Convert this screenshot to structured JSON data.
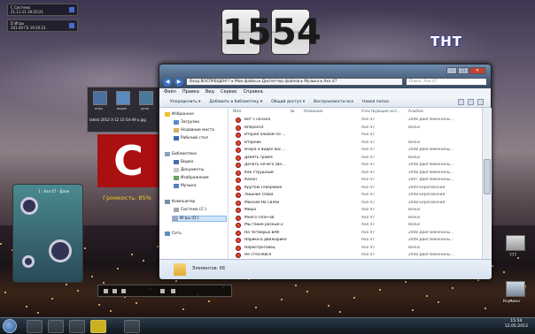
{
  "desktop": {
    "widget1": {
      "line1": "С  Система",
      "line2": "21.11.11  19:20:21"
    },
    "widget2": {
      "line1": "D  Игры",
      "line2": "101.40 ГБ  19:20:21"
    },
    "clock": {
      "hours": "15",
      "minutes": "54"
    },
    "tv_logo": "ТНТ",
    "gadget": {
      "items": [
        "игры",
        "видео",
        "дела"
      ],
      "file": "latest 2012-3-12 15-54-49 а.jpg"
    },
    "red_logo": "C",
    "volume": "Громкость: 85%",
    "player_title": "1 : Аха 47 - Дали",
    "icons": [
      {
        "label": "777"
      },
      {
        "label": "Корзина"
      }
    ]
  },
  "explorer": {
    "title_buttons": [
      "–",
      "□",
      "✕"
    ],
    "address": [
      "Вход ВОСПРЕЩЕН!!!",
      "Мои файлы",
      "Диспетчер файлов",
      "Музыка",
      "Аха 47"
    ],
    "search_placeholder": "Поиск: Аха 47",
    "menu": [
      "Файл",
      "Правка",
      "Вид",
      "Сервис",
      "Справка"
    ],
    "toolbar": [
      "Упорядочить ▾",
      "Добавить в библиотеку ▾",
      "Общий доступ ▾",
      "Воспроизвести все",
      "Новая папка"
    ],
    "nav": {
      "favorites": "Избранное",
      "favorites_items": [
        "Загрузки",
        "Недавние места",
        "Рабочий стол"
      ],
      "libraries": "Библиотеки",
      "libraries_items": [
        "Видео",
        "Документы",
        "Изображения",
        "Музыка"
      ],
      "computer": "Компьютер",
      "computer_items": [
        "Система (C:)",
        "Игры (D:)"
      ],
      "network": "Сеть"
    },
    "columns": [
      "Имя",
      "№",
      "Название",
      "Участвующие исп...",
      "Альбом"
    ],
    "rows": [
      {
        "name": "Вот с начала",
        "artist": "Аха 47",
        "album": "2008 Двиглиженины..."
      },
      {
        "name": "Вперался",
        "artist": "Аха 47",
        "album": "Bonus"
      },
      {
        "name": "Второй альбом по ...",
        "artist": "Аха 47",
        "album": ""
      },
      {
        "name": "Вторник",
        "artist": "Аха 47",
        "album": "Bonus"
      },
      {
        "name": "Вчера я видел вас ...",
        "artist": "Аха 47",
        "album": "2008 Двиглиженины..."
      },
      {
        "name": "Девять грамм",
        "artist": "Аха 47",
        "album": "Bonus"
      },
      {
        "name": "Делать нечего (Ва...",
        "artist": "Аха 47",
        "album": "2008 Двиглиженины..."
      },
      {
        "name": "Как струшный",
        "artist": "Аха 47",
        "album": "2008 Двиглиженины..."
      },
      {
        "name": "Канон",
        "artist": "Аха 47",
        "album": "2007 Двиглиженины..."
      },
      {
        "name": "Крутою Токеревин",
        "artist": "Аха 47",
        "album": "2009 Березовский"
      },
      {
        "name": "Лишние слова",
        "artist": "Аха 47",
        "album": "2008 Березовский"
      },
      {
        "name": "Максим На Связи",
        "artist": "Аха 47",
        "album": "2008 Березовский"
      },
      {
        "name": "Миша",
        "artist": "Аха 47",
        "album": "Bonus"
      },
      {
        "name": "Много План-ов",
        "artist": "Аха 47",
        "album": "Bonus"
      },
      {
        "name": "Мы такие разные-2",
        "artist": "Аха 47",
        "album": "Bonus"
      },
      {
        "name": "На Четверых ВАК",
        "artist": "Аха 47",
        "album": "2008 Двиглиженины..."
      },
      {
        "name": "Нарики в движарике",
        "artist": "Аха 47",
        "album": "2008 Двиглиженины..."
      },
      {
        "name": "Наркотроговец",
        "artist": "Аха 47",
        "album": "Bonus"
      },
      {
        "name": "Не стесняйся",
        "artist": "Аха 47",
        "album": "2008 Двиглиженины..."
      }
    ],
    "status": "Элементов: 68"
  },
  "taskbar": {
    "time": "15:54",
    "date": "12.05.2012"
  }
}
